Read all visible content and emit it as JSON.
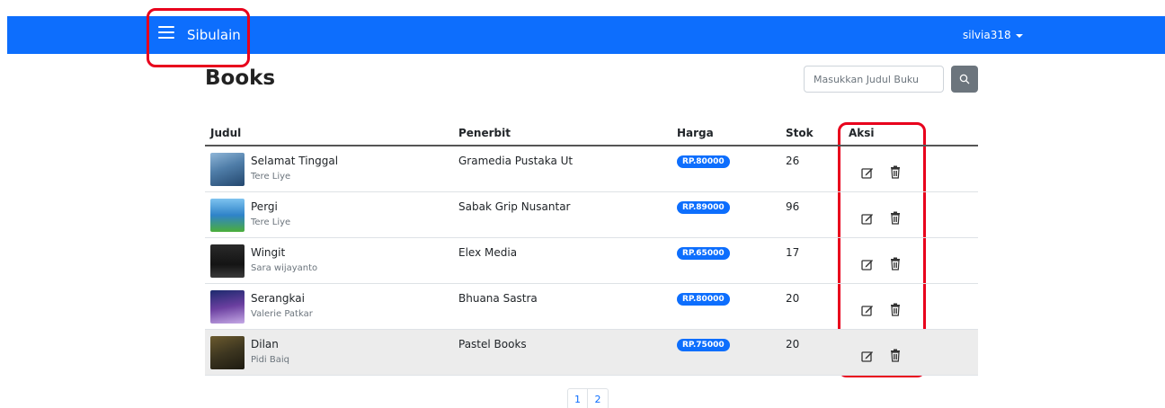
{
  "navbar": {
    "brand": "Sibulain",
    "user": "silvia318",
    "color": "#0d6efd",
    "menu_icon": "hamburger-icon"
  },
  "page": {
    "title": "Books"
  },
  "search": {
    "placeholder": "Masukkan Judul Buku",
    "value": "",
    "icon": "search-icon"
  },
  "table": {
    "headers": [
      "Judul",
      "Penerbit",
      "Harga",
      "Stok",
      "Aksi"
    ],
    "rows": [
      {
        "title": "Selamat Tinggal",
        "author": "Tere Liye",
        "penerbit": "Gramedia Pustaka Ut",
        "harga": "RP.80000",
        "stok": "26"
      },
      {
        "title": "Pergi",
        "author": "Tere Liye",
        "penerbit": "Sabak Grip Nusantar",
        "harga": "RP.89000",
        "stok": "96"
      },
      {
        "title": "Wingit",
        "author": "Sara wijayanto",
        "penerbit": "Elex Media",
        "harga": "RP.65000",
        "stok": "17"
      },
      {
        "title": "Serangkai",
        "author": "Valerie Patkar",
        "penerbit": "Bhuana Sastra",
        "harga": "RP.80000",
        "stok": "20"
      },
      {
        "title": "Dilan",
        "author": "Pidi Baiq",
        "penerbit": "Pastel Books",
        "harga": "RP.75000",
        "stok": "20"
      }
    ],
    "action_icons": [
      "edit-icon",
      "trash-icon"
    ]
  },
  "pagination": {
    "pages": [
      "1",
      "2"
    ]
  }
}
